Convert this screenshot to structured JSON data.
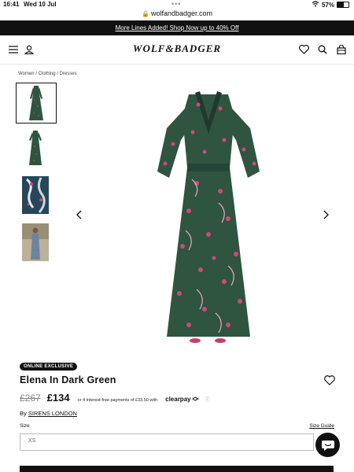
{
  "statusbar": {
    "time": "16:41",
    "date": "Wed 10 Jul",
    "url": "wolfandbadger.com",
    "battery": "57%",
    "battery_level": 0.57
  },
  "promo": {
    "text": "More Lines Added! Shop Now up to 40% Off"
  },
  "header": {
    "logo": "WOLF&BADGER"
  },
  "breadcrumb": "Women / Clothing / Dresses",
  "thumbnails": [
    {
      "name": "thumb-front",
      "selected": true
    },
    {
      "name": "thumb-front-2",
      "selected": false
    },
    {
      "name": "thumb-detail",
      "selected": false
    },
    {
      "name": "thumb-model",
      "selected": false
    }
  ],
  "product": {
    "badge": "ONLINE EXCLUSIVE",
    "title": "Elena In Dark Green",
    "old_price": "£267",
    "price": "£134",
    "installments": "or 4 interest-free payments of £33.50 with",
    "clearpay": "clearpay",
    "by_prefix": "By",
    "brand": "SIRENS LONDON"
  },
  "size": {
    "label": "Size",
    "guide": "Size Guide",
    "selected": "XS"
  },
  "colors": {
    "dress_green": "#2f5440",
    "dress_pink": "#d1477d",
    "black": "#111111"
  }
}
